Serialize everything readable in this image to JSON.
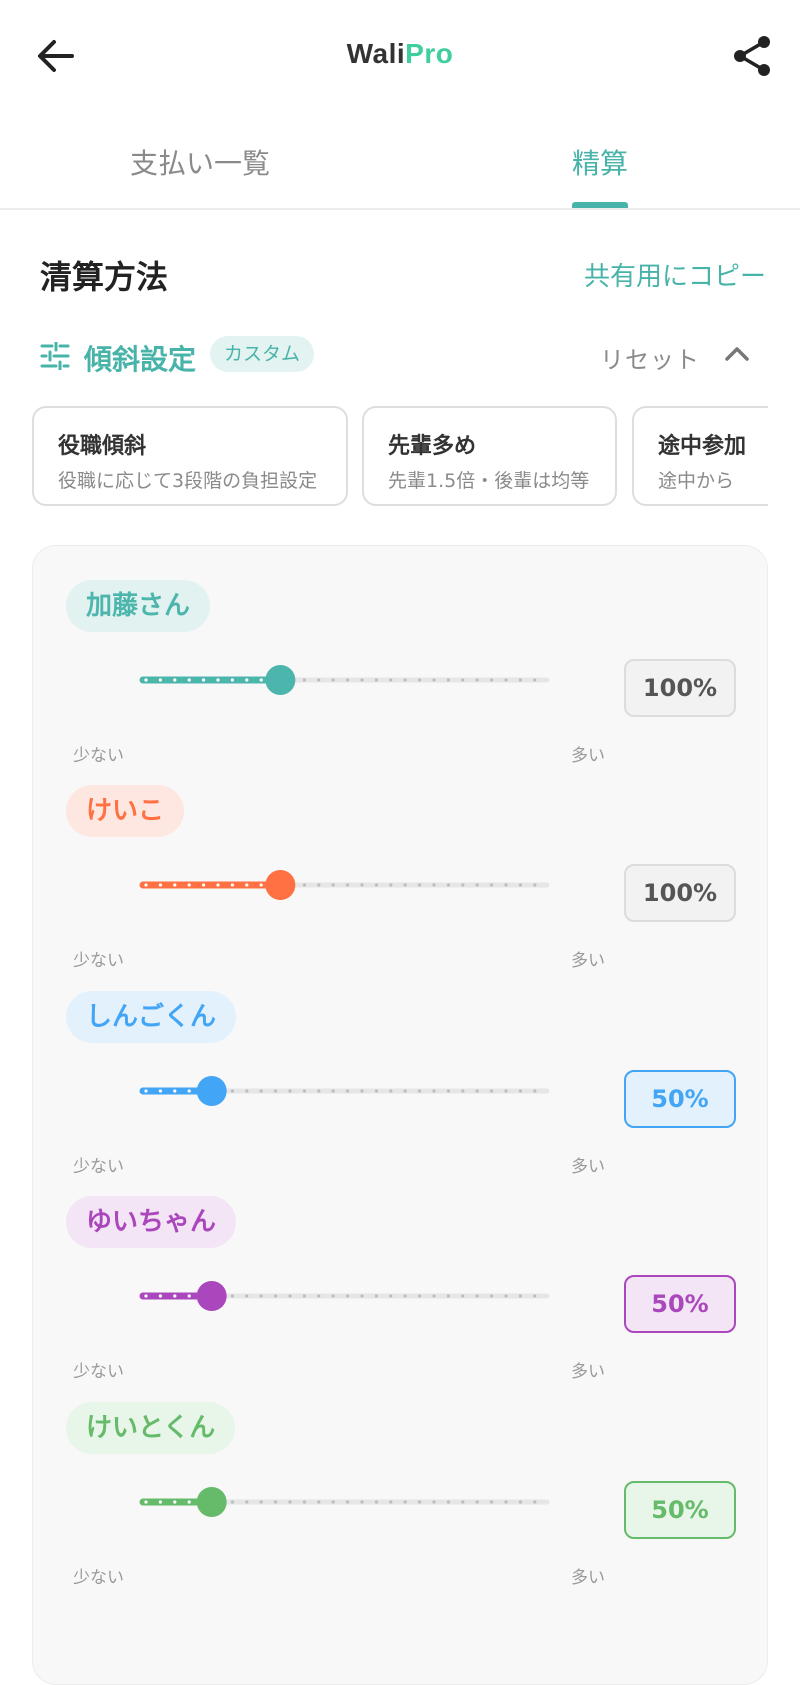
{
  "app": {
    "logo_part1": "Wali",
    "logo_part2": "Pro"
  },
  "header": {
    "back_icon": "arrow-left-icon",
    "share_icon": "share-icon"
  },
  "tabs": [
    {
      "label": "支払い一覧",
      "active": false
    },
    {
      "label": "精算",
      "active": true
    }
  ],
  "settlement": {
    "title": "清算方法",
    "copy_label": "共有用にコピー"
  },
  "gradient": {
    "icon": "tune-icon",
    "title": "傾斜設定",
    "badge": "カスタム",
    "reset_label": "リセット",
    "collapse_icon": "chevron-up-icon"
  },
  "presets": [
    {
      "title": "役職傾斜",
      "desc": "役職に応じて3段階の負担設定"
    },
    {
      "title": "先輩多め",
      "desc": "先輩1.5倍・後輩は均等"
    },
    {
      "title": "途中参加",
      "desc": "途中から"
    }
  ],
  "slider_labels": {
    "low": "少ない",
    "high": "多い"
  },
  "members": [
    {
      "name": "加藤さん",
      "percent": "100%",
      "level": 0.34,
      "color": "#4db6ac",
      "chip_bg": "#e2f2f0",
      "box_style": "neutral"
    },
    {
      "name": "けいこ",
      "percent": "100%",
      "level": 0.34,
      "color": "#ff7043",
      "chip_bg": "#fde7e0",
      "box_style": "neutral"
    },
    {
      "name": "しんごくん",
      "percent": "50%",
      "level": 0.17,
      "color": "#42a5f5",
      "chip_bg": "#e3f1fc",
      "box_style": "accent"
    },
    {
      "name": "ゆいちゃん",
      "percent": "50%",
      "level": 0.17,
      "color": "#ab47bc",
      "chip_bg": "#f3e5f5",
      "box_style": "accent"
    },
    {
      "name": "けいとくん",
      "percent": "50%",
      "level": 0.17,
      "color": "#66bb6a",
      "chip_bg": "#e8f5e9",
      "box_style": "accent"
    }
  ]
}
